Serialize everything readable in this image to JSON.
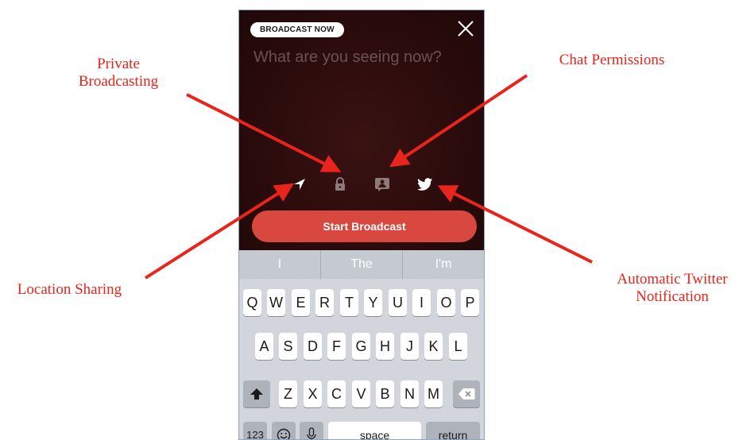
{
  "annotations": {
    "private_line1": "Private",
    "private_line2": "Broadcasting",
    "chat": "Chat Permissions",
    "location": "Location Sharing",
    "twitter_line1": "Automatic Twitter",
    "twitter_line2": "Notification"
  },
  "colors": {
    "annotation_red": "#e8241c",
    "broadcast_button": "#d9483f",
    "screen_bg": "#2a0b0b",
    "keyboard_bg": "#d2d5db"
  },
  "broadcast": {
    "badge": "BROADCAST NOW",
    "placeholder": "What are you seeing now?",
    "start_button": "Start Broadcast",
    "icons": [
      "location-arrow-icon",
      "lock-icon",
      "chat-person-icon",
      "twitter-bird-icon"
    ],
    "close_icon": "close-icon"
  },
  "keyboard": {
    "suggestions": [
      "I",
      "The",
      "I'm"
    ],
    "row1": [
      "Q",
      "W",
      "E",
      "R",
      "T",
      "Y",
      "U",
      "I",
      "O",
      "P"
    ],
    "row2": [
      "A",
      "S",
      "D",
      "F",
      "G",
      "H",
      "J",
      "K",
      "L"
    ],
    "row3": [
      "Z",
      "X",
      "C",
      "V",
      "B",
      "N",
      "M"
    ],
    "numbers_key": "123",
    "space_key": "space",
    "return_key": "return",
    "shift_icon": "shift-icon",
    "delete_icon": "delete-icon",
    "emoji_icon": "emoji-icon",
    "mic_icon": "microphone-icon"
  }
}
